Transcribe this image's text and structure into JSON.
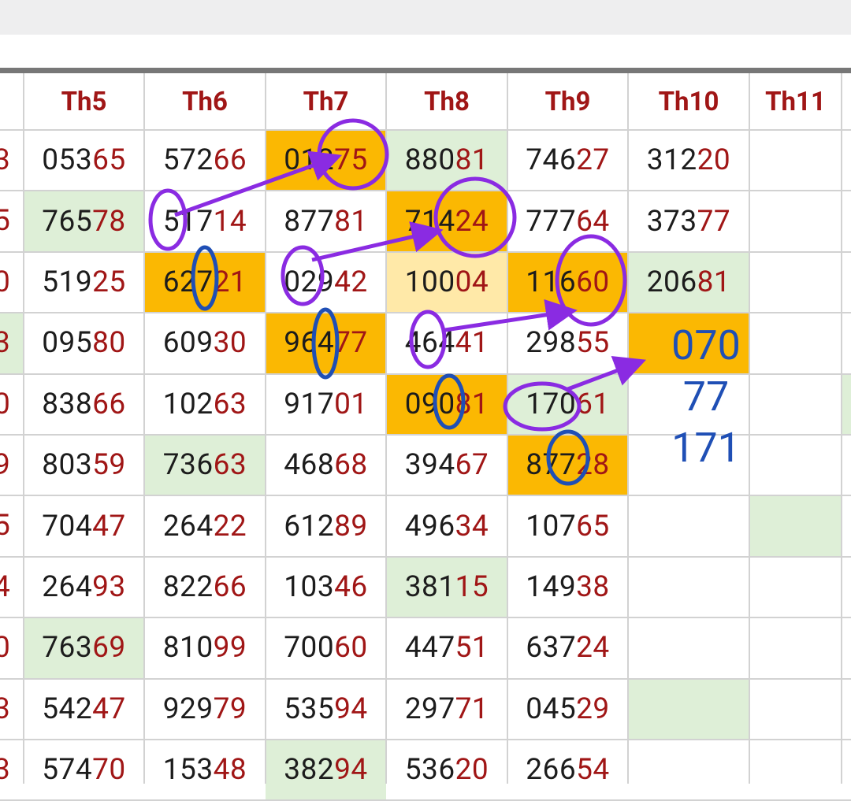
{
  "colors": {
    "header_text": "#a01616",
    "highlight_orange": "#fbb802",
    "highlight_light_orange": "#ffe9a8",
    "highlight_green": "#deefd7",
    "annotation_purple": "#8a2be2",
    "annotation_blue": "#1f4fb5"
  },
  "columns": [
    "Th5",
    "Th6",
    "Th7",
    "Th8",
    "Th9",
    "Th10",
    "Th11"
  ],
  "left_edge_tails": [
    "3",
    "5",
    "0",
    "3",
    "0",
    "9",
    "5",
    "4",
    "0",
    "3",
    "3"
  ],
  "rows": [
    [
      {
        "n": "05365",
        "h": ""
      },
      {
        "n": "57266",
        "h": ""
      },
      {
        "n": "01275",
        "h": "orange"
      },
      {
        "n": "88081",
        "h": "green"
      },
      {
        "n": "74627",
        "h": ""
      },
      {
        "n": "31220",
        "h": ""
      },
      {
        "n": "",
        "h": ""
      }
    ],
    [
      {
        "n": "76578",
        "h": "green"
      },
      {
        "n": "51714",
        "h": ""
      },
      {
        "n": "87781",
        "h": ""
      },
      {
        "n": "71424",
        "h": "orange"
      },
      {
        "n": "77764",
        "h": ""
      },
      {
        "n": "37377",
        "h": ""
      },
      {
        "n": "",
        "h": ""
      }
    ],
    [
      {
        "n": "51925",
        "h": ""
      },
      {
        "n": "62721",
        "h": "orange"
      },
      {
        "n": "02942",
        "h": ""
      },
      {
        "n": "10004",
        "h": "light"
      },
      {
        "n": "11660",
        "h": "orange"
      },
      {
        "n": "20681",
        "h": "green"
      },
      {
        "n": "",
        "h": ""
      }
    ],
    [
      {
        "n": "09580",
        "h": ""
      },
      {
        "n": "60930",
        "h": ""
      },
      {
        "n": "96477",
        "h": "orange"
      },
      {
        "n": "46441",
        "h": ""
      },
      {
        "n": "29855",
        "h": ""
      },
      {
        "n": "",
        "h": "orange"
      },
      {
        "n": "",
        "h": ""
      }
    ],
    [
      {
        "n": "83866",
        "h": ""
      },
      {
        "n": "10263",
        "h": ""
      },
      {
        "n": "91701",
        "h": ""
      },
      {
        "n": "09081",
        "h": "orange"
      },
      {
        "n": "17061",
        "h": "green"
      },
      {
        "n": "",
        "h": ""
      },
      {
        "n": "",
        "h": ""
      }
    ],
    [
      {
        "n": "80359",
        "h": ""
      },
      {
        "n": "73663",
        "h": "green"
      },
      {
        "n": "46868",
        "h": ""
      },
      {
        "n": "39467",
        "h": ""
      },
      {
        "n": "87728",
        "h": "orange"
      },
      {
        "n": "",
        "h": ""
      },
      {
        "n": "",
        "h": ""
      }
    ],
    [
      {
        "n": "70447",
        "h": ""
      },
      {
        "n": "26422",
        "h": ""
      },
      {
        "n": "61289",
        "h": ""
      },
      {
        "n": "49634",
        "h": ""
      },
      {
        "n": "10765",
        "h": ""
      },
      {
        "n": "",
        "h": ""
      },
      {
        "n": "",
        "h": "green"
      }
    ],
    [
      {
        "n": "26493",
        "h": ""
      },
      {
        "n": "82266",
        "h": ""
      },
      {
        "n": "10346",
        "h": ""
      },
      {
        "n": "38115",
        "h": "green"
      },
      {
        "n": "14938",
        "h": ""
      },
      {
        "n": "",
        "h": ""
      },
      {
        "n": "",
        "h": ""
      }
    ],
    [
      {
        "n": "76369",
        "h": "green"
      },
      {
        "n": "81099",
        "h": ""
      },
      {
        "n": "70060",
        "h": ""
      },
      {
        "n": "44751",
        "h": ""
      },
      {
        "n": "63724",
        "h": ""
      },
      {
        "n": "",
        "h": ""
      },
      {
        "n": "",
        "h": ""
      }
    ],
    [
      {
        "n": "54247",
        "h": ""
      },
      {
        "n": "92979",
        "h": ""
      },
      {
        "n": "53594",
        "h": ""
      },
      {
        "n": "29771",
        "h": ""
      },
      {
        "n": "04529",
        "h": ""
      },
      {
        "n": "",
        "h": "green"
      },
      {
        "n": "",
        "h": ""
      }
    ],
    [
      {
        "n": "57470",
        "h": ""
      },
      {
        "n": "15348",
        "h": ""
      },
      {
        "n": "38294",
        "h": "green"
      },
      {
        "n": "53620",
        "h": ""
      },
      {
        "n": "26654",
        "h": ""
      },
      {
        "n": "",
        "h": ""
      },
      {
        "n": "",
        "h": ""
      }
    ]
  ],
  "annotation_notes": [
    "070",
    "77",
    "171"
  ]
}
